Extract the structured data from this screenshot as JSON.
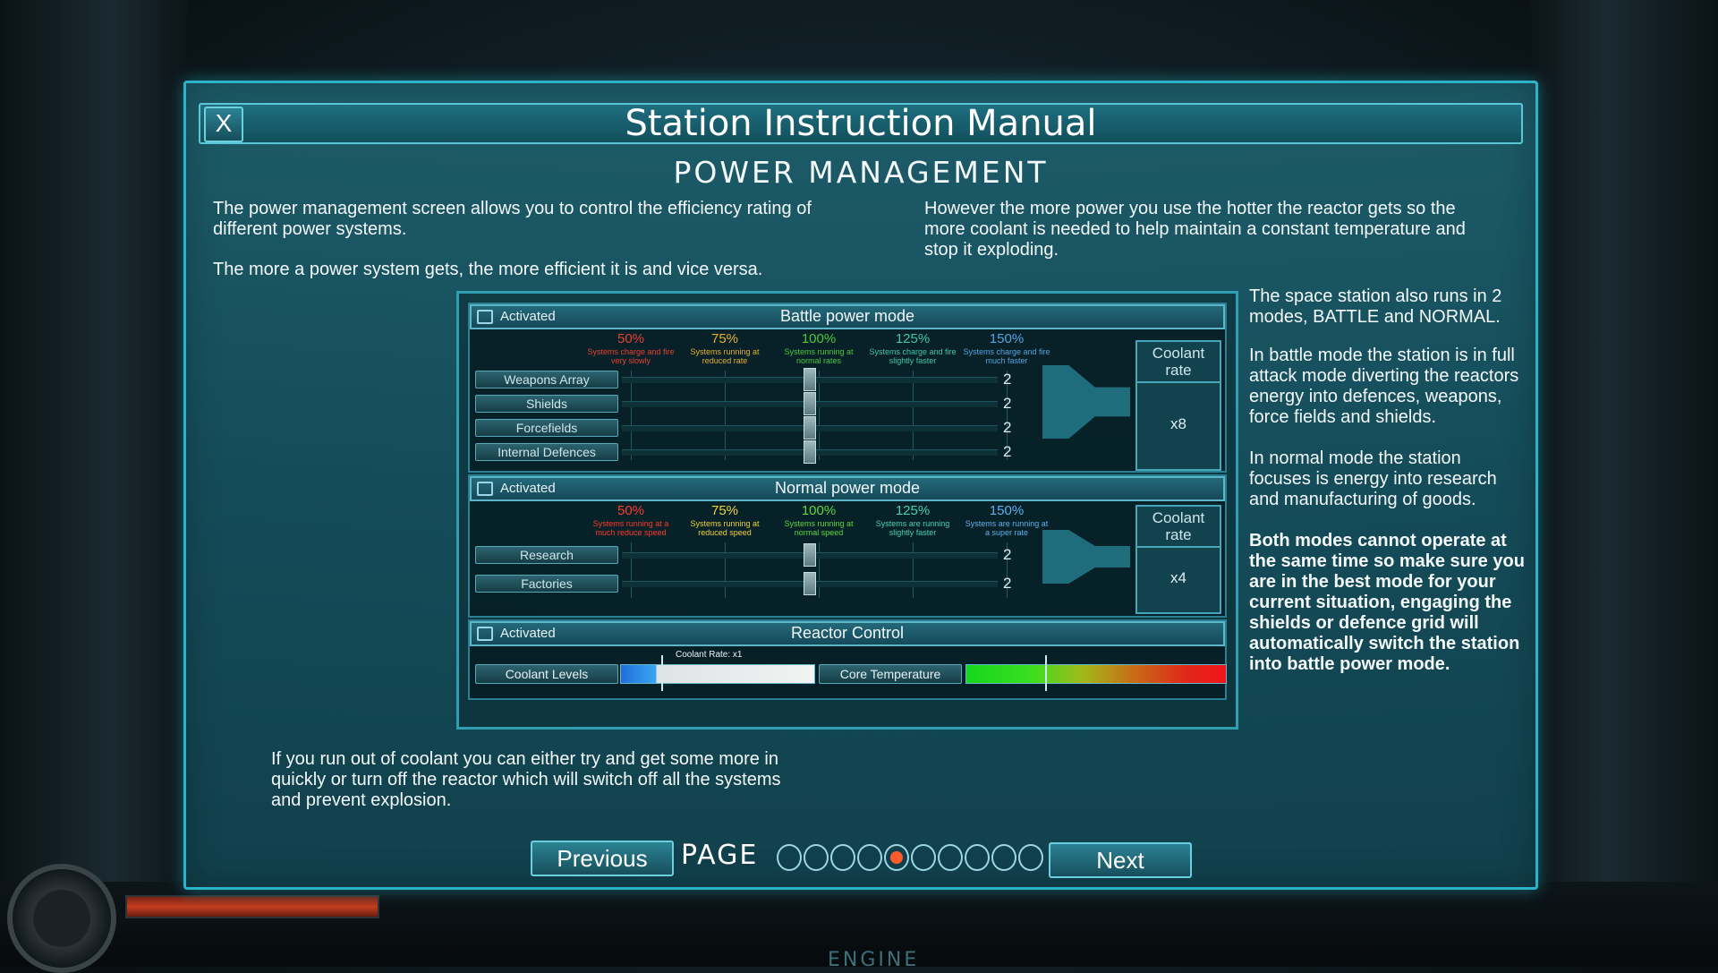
{
  "window": {
    "title": "Station Instruction Manual",
    "close_label": "X",
    "subtitle": "Power Management"
  },
  "text": {
    "intro1": "The power management screen allows you to control the efficiency rating of different power systems.",
    "intro2": "The more a power system gets, the more efficient it is and vice versa.",
    "intro3": "However the more power you use the hotter the reactor gets so the more coolant is needed to help maintain a constant temperature and stop it exploding.",
    "side1": "The space station also runs in 2 modes, BATTLE and NORMAL.",
    "side2": "In battle mode the station is in full attack mode diverting the reactors energy into defences, weapons, force fields and shields.",
    "side3": "In normal mode the station focuses is energy into research and manufacturing of goods.",
    "side4": "Both modes cannot operate at the same time so make sure you are in the best mode for your current situation, engaging the shields or defence grid will automatically switch the station into battle power mode.",
    "footer": "If you run out of coolant you can either try and get some more in quickly or turn off the reactor which will switch off all the systems and prevent explosion."
  },
  "battle": {
    "activated": "Activated",
    "title": "Battle power mode",
    "levels": [
      {
        "pct": "50%",
        "desc": "Systems charge and fire very slowly",
        "color": "#e8402e"
      },
      {
        "pct": "75%",
        "desc": "Systems running at reduced rate",
        "color": "#e7b02c"
      },
      {
        "pct": "100%",
        "desc": "Systems running at normal rates",
        "color": "#47c93a"
      },
      {
        "pct": "125%",
        "desc": "Systems charge and fire slightly faster",
        "color": "#3fc7a5"
      },
      {
        "pct": "150%",
        "desc": "Systems charge and fire much faster",
        "color": "#52a6e0"
      }
    ],
    "rows": [
      {
        "label": "Weapons Array",
        "value": "2"
      },
      {
        "label": "Shields",
        "value": "2"
      },
      {
        "label": "Forcefields",
        "value": "2"
      },
      {
        "label": "Internal Defences",
        "value": "2"
      }
    ],
    "coolant_label": "Coolant rate",
    "coolant_value": "x8"
  },
  "normal": {
    "activated": "Activated",
    "title": "Normal power mode",
    "levels": [
      {
        "pct": "50%",
        "desc": "Systems running at a much reduce speed",
        "color": "#ff3b2c"
      },
      {
        "pct": "75%",
        "desc": "Systems running at reduced speed",
        "color": "#f0d23a"
      },
      {
        "pct": "100%",
        "desc": "Systems running at normal speed",
        "color": "#5ad83e"
      },
      {
        "pct": "125%",
        "desc": "Systems are running slightly faster",
        "color": "#46d0b4"
      },
      {
        "pct": "150%",
        "desc": "Systems are running at a super rate",
        "color": "#5cb2ee"
      }
    ],
    "rows": [
      {
        "label": "Research",
        "value": "2"
      },
      {
        "label": "Factories",
        "value": "2"
      }
    ],
    "coolant_label": "Coolant rate",
    "coolant_value": "x4"
  },
  "reactor": {
    "activated": "Activated",
    "title": "Reactor Control",
    "coolant_levels_label": "Coolant Levels",
    "coolant_rate_label": "Coolant Rate: x1",
    "core_temp_label": "Core Temperature"
  },
  "pager": {
    "previous": "Previous",
    "next": "Next",
    "label": "PAGE",
    "total": 10,
    "current": 5,
    "active_color": "#ff5a2b"
  },
  "background": {
    "engine_label": "ENGINE"
  }
}
